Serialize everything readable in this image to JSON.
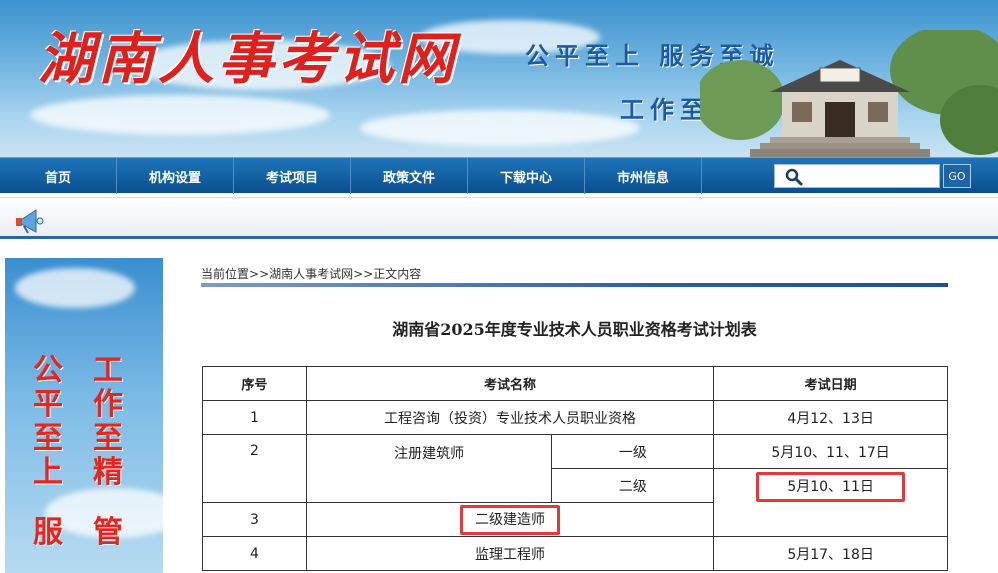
{
  "banner": {
    "title": "湖南人事考试网",
    "slogan_line1": "公平至上  服务至诚",
    "slogan_line2": "工作至精  管理至严"
  },
  "nav": {
    "items": [
      "首页",
      "机构设置",
      "考试项目",
      "政策文件",
      "下载中心",
      "市州信息"
    ],
    "search_placeholder": "",
    "go_label": "GO"
  },
  "sidebar": {
    "col1": [
      "公",
      "平",
      "至",
      "上",
      "服"
    ],
    "col2": [
      "工",
      "作",
      "至",
      "精",
      "管"
    ]
  },
  "breadcrumb": {
    "prefix": "当前位置",
    "sep": ">>",
    "site": "湖南人事考试网",
    "page": "正文内容"
  },
  "page_title": "湖南省2025年度专业技术人员职业资格考试计划表",
  "table": {
    "headers": [
      "序号",
      "考试名称",
      "考试日期"
    ],
    "rows": [
      {
        "no": "1",
        "name": "工程咨询（投资）专业技术人员职业资格",
        "date": "4月12、13日"
      },
      {
        "no": "2",
        "name": "注册建筑师",
        "sub": [
          {
            "level": "一级",
            "date": "5月10、11、17日"
          },
          {
            "level": "二级",
            "date": "5月10、11日"
          }
        ]
      },
      {
        "no": "3",
        "name": "二级建造师",
        "date": ""
      },
      {
        "no": "4",
        "name": "监理工程师",
        "date": "5月17、18日"
      }
    ]
  },
  "colors": {
    "nav_bg": "#0a4f8e",
    "highlight": "#e03a3a",
    "slogan": "#1a5ba8",
    "title_red": "#e0201c"
  }
}
